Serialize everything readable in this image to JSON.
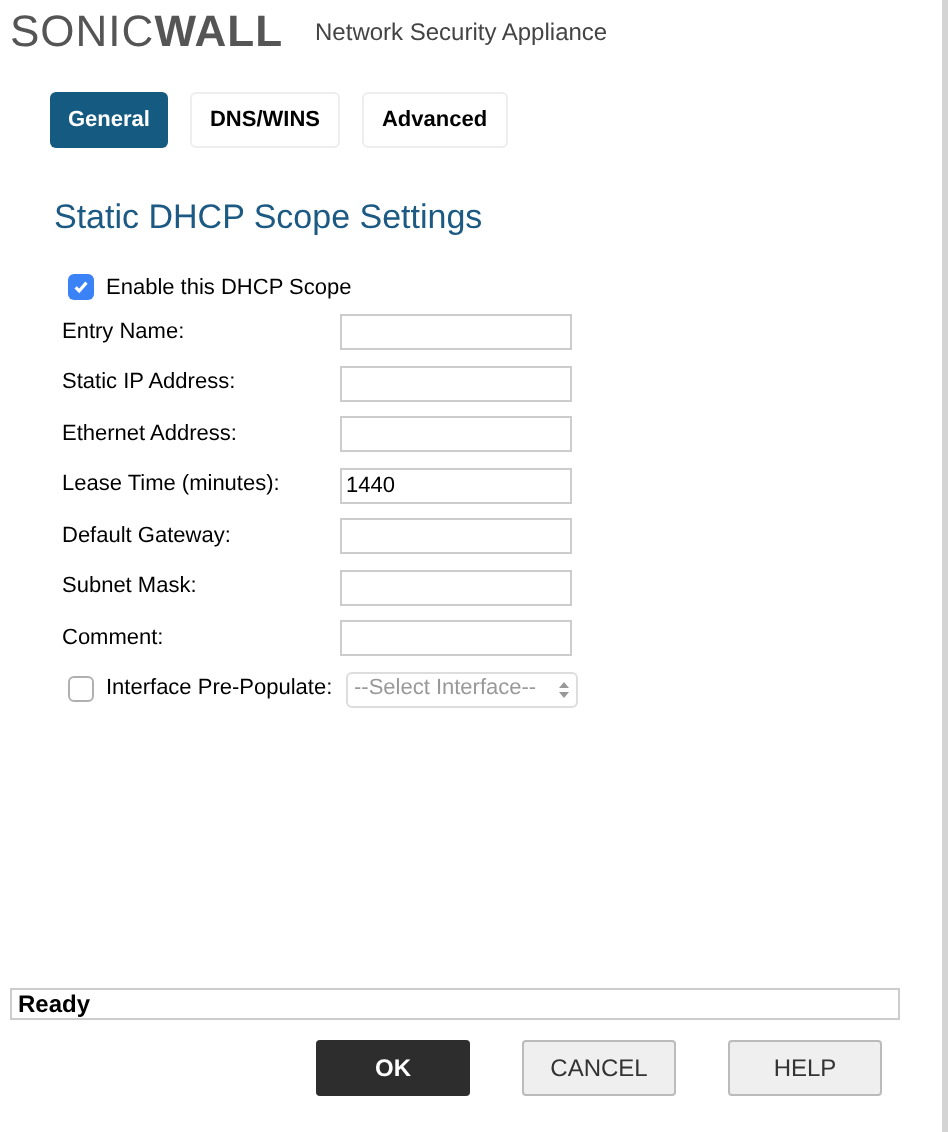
{
  "header": {
    "logo": "SONIC**WALL**",
    "product": "Network Security Appliance"
  },
  "tabs": [
    {
      "label": "General",
      "selected": true
    },
    {
      "label": "DNS/WINS",
      "selected": false
    },
    {
      "label": "Advanced",
      "selected": false
    }
  ],
  "heading": "Static DHCP Scope Settings",
  "enable": {
    "label": "Enable this DHCP Scope",
    "checked": true
  },
  "fields": [
    {
      "kind": "text",
      "label": "Entry Name:"
    },
    {
      "kind": "text",
      "label": "Static IP Address:"
    },
    {
      "kind": "text",
      "label": "Ethernet Address:"
    },
    {
      "kind": "text",
      "label": "Lease Time (minutes):",
      "value": "1440"
    },
    {
      "kind": "text",
      "label": "Default Gateway:"
    },
    {
      "kind": "text",
      "label": "Subnet Mask:"
    },
    {
      "kind": "text",
      "label": "Comment:"
    },
    {
      "kind": "select",
      "label": "Interface Pre-Populate:",
      "checked": false,
      "value": "--Select Interface--",
      "disabled": true
    }
  ],
  "status_bar": "Ready",
  "buttons": [
    {
      "label": "OK",
      "kind": "primary"
    },
    {
      "label": "CANCEL",
      "kind": "secondary"
    },
    {
      "label": "HELP",
      "kind": "secondary"
    }
  ]
}
